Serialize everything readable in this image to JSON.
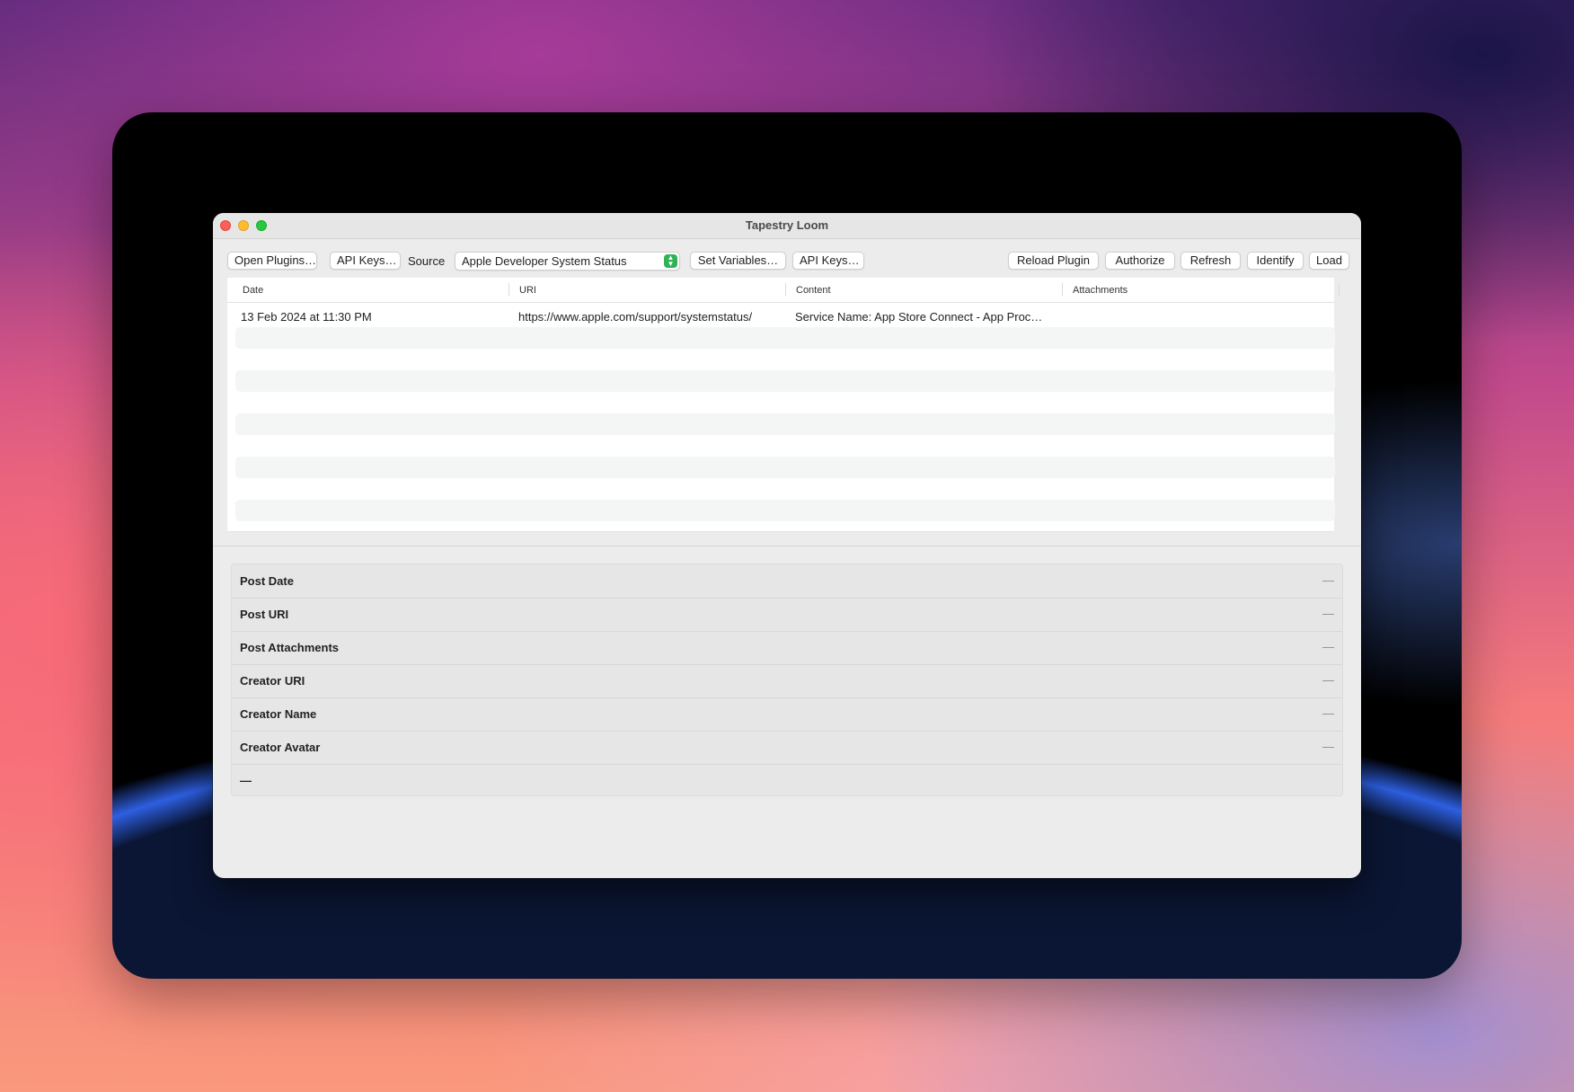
{
  "window": {
    "title": "Tapestry Loom"
  },
  "toolbar": {
    "open_plugins": "Open Plugins…",
    "api_keys_1": "API Keys…",
    "source_label": "Source",
    "source_value": "Apple Developer System Status",
    "set_variables": "Set Variables…",
    "api_keys_2": "API Keys…",
    "reload_plugin": "Reload Plugin",
    "authorize": "Authorize",
    "refresh": "Refresh",
    "identify": "Identify",
    "load": "Load"
  },
  "table": {
    "columns": [
      "Date",
      "URI",
      "Content",
      "Attachments"
    ],
    "rows": [
      {
        "date": "13 Feb 2024 at 11:30 PM",
        "uri": "https://www.apple.com/support/systemstatus/",
        "content": "Service Name: App Store Connect - App Proc…",
        "attachments": ""
      }
    ]
  },
  "detail": {
    "fields": [
      {
        "label": "Post Date",
        "value": "—"
      },
      {
        "label": "Post URI",
        "value": "—"
      },
      {
        "label": "Post Attachments",
        "value": "—"
      },
      {
        "label": "Creator URI",
        "value": "—"
      },
      {
        "label": "Creator Name",
        "value": "—"
      },
      {
        "label": "Creator Avatar",
        "value": "—"
      }
    ],
    "footer": "—"
  },
  "colors": {
    "close": "#fe5f57",
    "minimize": "#febc2e",
    "maximize": "#28c840",
    "select_accent": "#2fb355"
  }
}
